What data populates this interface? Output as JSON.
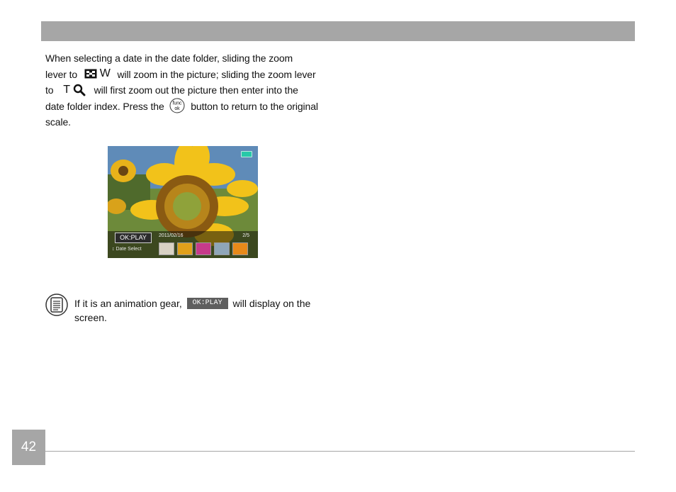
{
  "paragraph": {
    "line1": "When selecting a date in the date folder, sliding the zoom",
    "line2a": "lever to",
    "wide_letter": "W",
    "line2b": "will zoom in the picture; sliding the zoom lever",
    "line3a": "to",
    "tele_letter": "T",
    "line3b": "will first zoom out the picture then enter into the",
    "line4a": "date folder index. Press the",
    "func_icon_top": "func",
    "func_icon_bottom": "ok",
    "line4b": "button to return to the original",
    "line5": "scale."
  },
  "screenshot": {
    "ok_play": "OK:PLAY",
    "date": "2011/02/16",
    "count": "2/5",
    "select_label": "Date Select",
    "icons": [
      "battery-icon",
      "up-down-arrow-icon"
    ]
  },
  "note": {
    "line1a": "If it is an animation gear,",
    "badge": "OK:PLAY",
    "line1b": "will display on the",
    "line2": "screen."
  },
  "footer": {
    "page_number": "42"
  },
  "colors": {
    "header_bar": "#a6a6a6",
    "page_box": "#a6a6a6",
    "badge_bg": "#5e5e5e"
  }
}
